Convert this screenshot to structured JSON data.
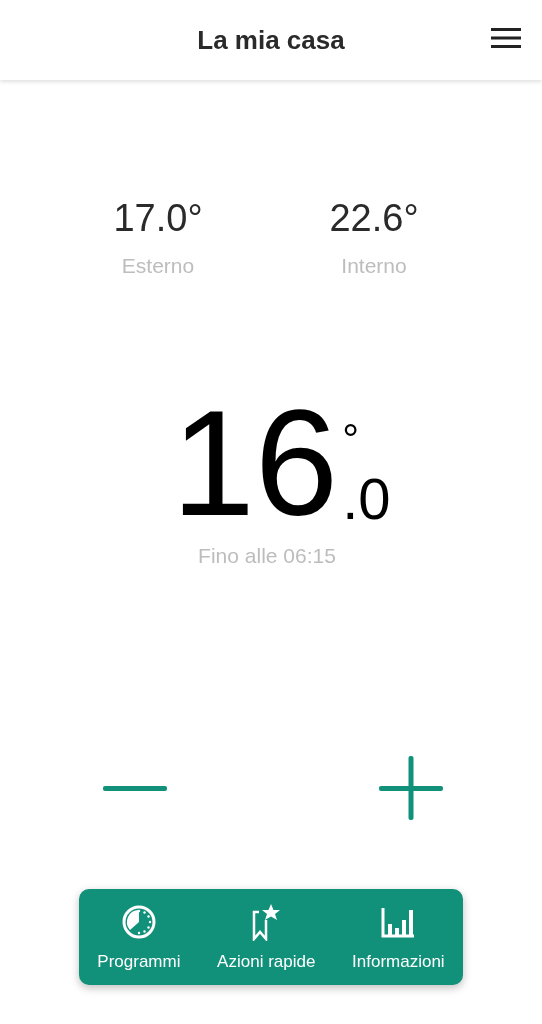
{
  "header": {
    "title": "La mia casa"
  },
  "readings": [
    {
      "value": "17.0°",
      "label": "Esterno"
    },
    {
      "value": "22.6°",
      "label": "Interno"
    }
  ],
  "setpoint": {
    "whole": "16",
    "decimal": ".0",
    "unit": "°",
    "until": "Fino alle 06:15"
  },
  "nav": [
    {
      "kind": "clock",
      "label": "Programmi"
    },
    {
      "kind": "bookmark",
      "label": "Azioni rapide"
    },
    {
      "kind": "chart",
      "label": "Informazioni"
    }
  ]
}
